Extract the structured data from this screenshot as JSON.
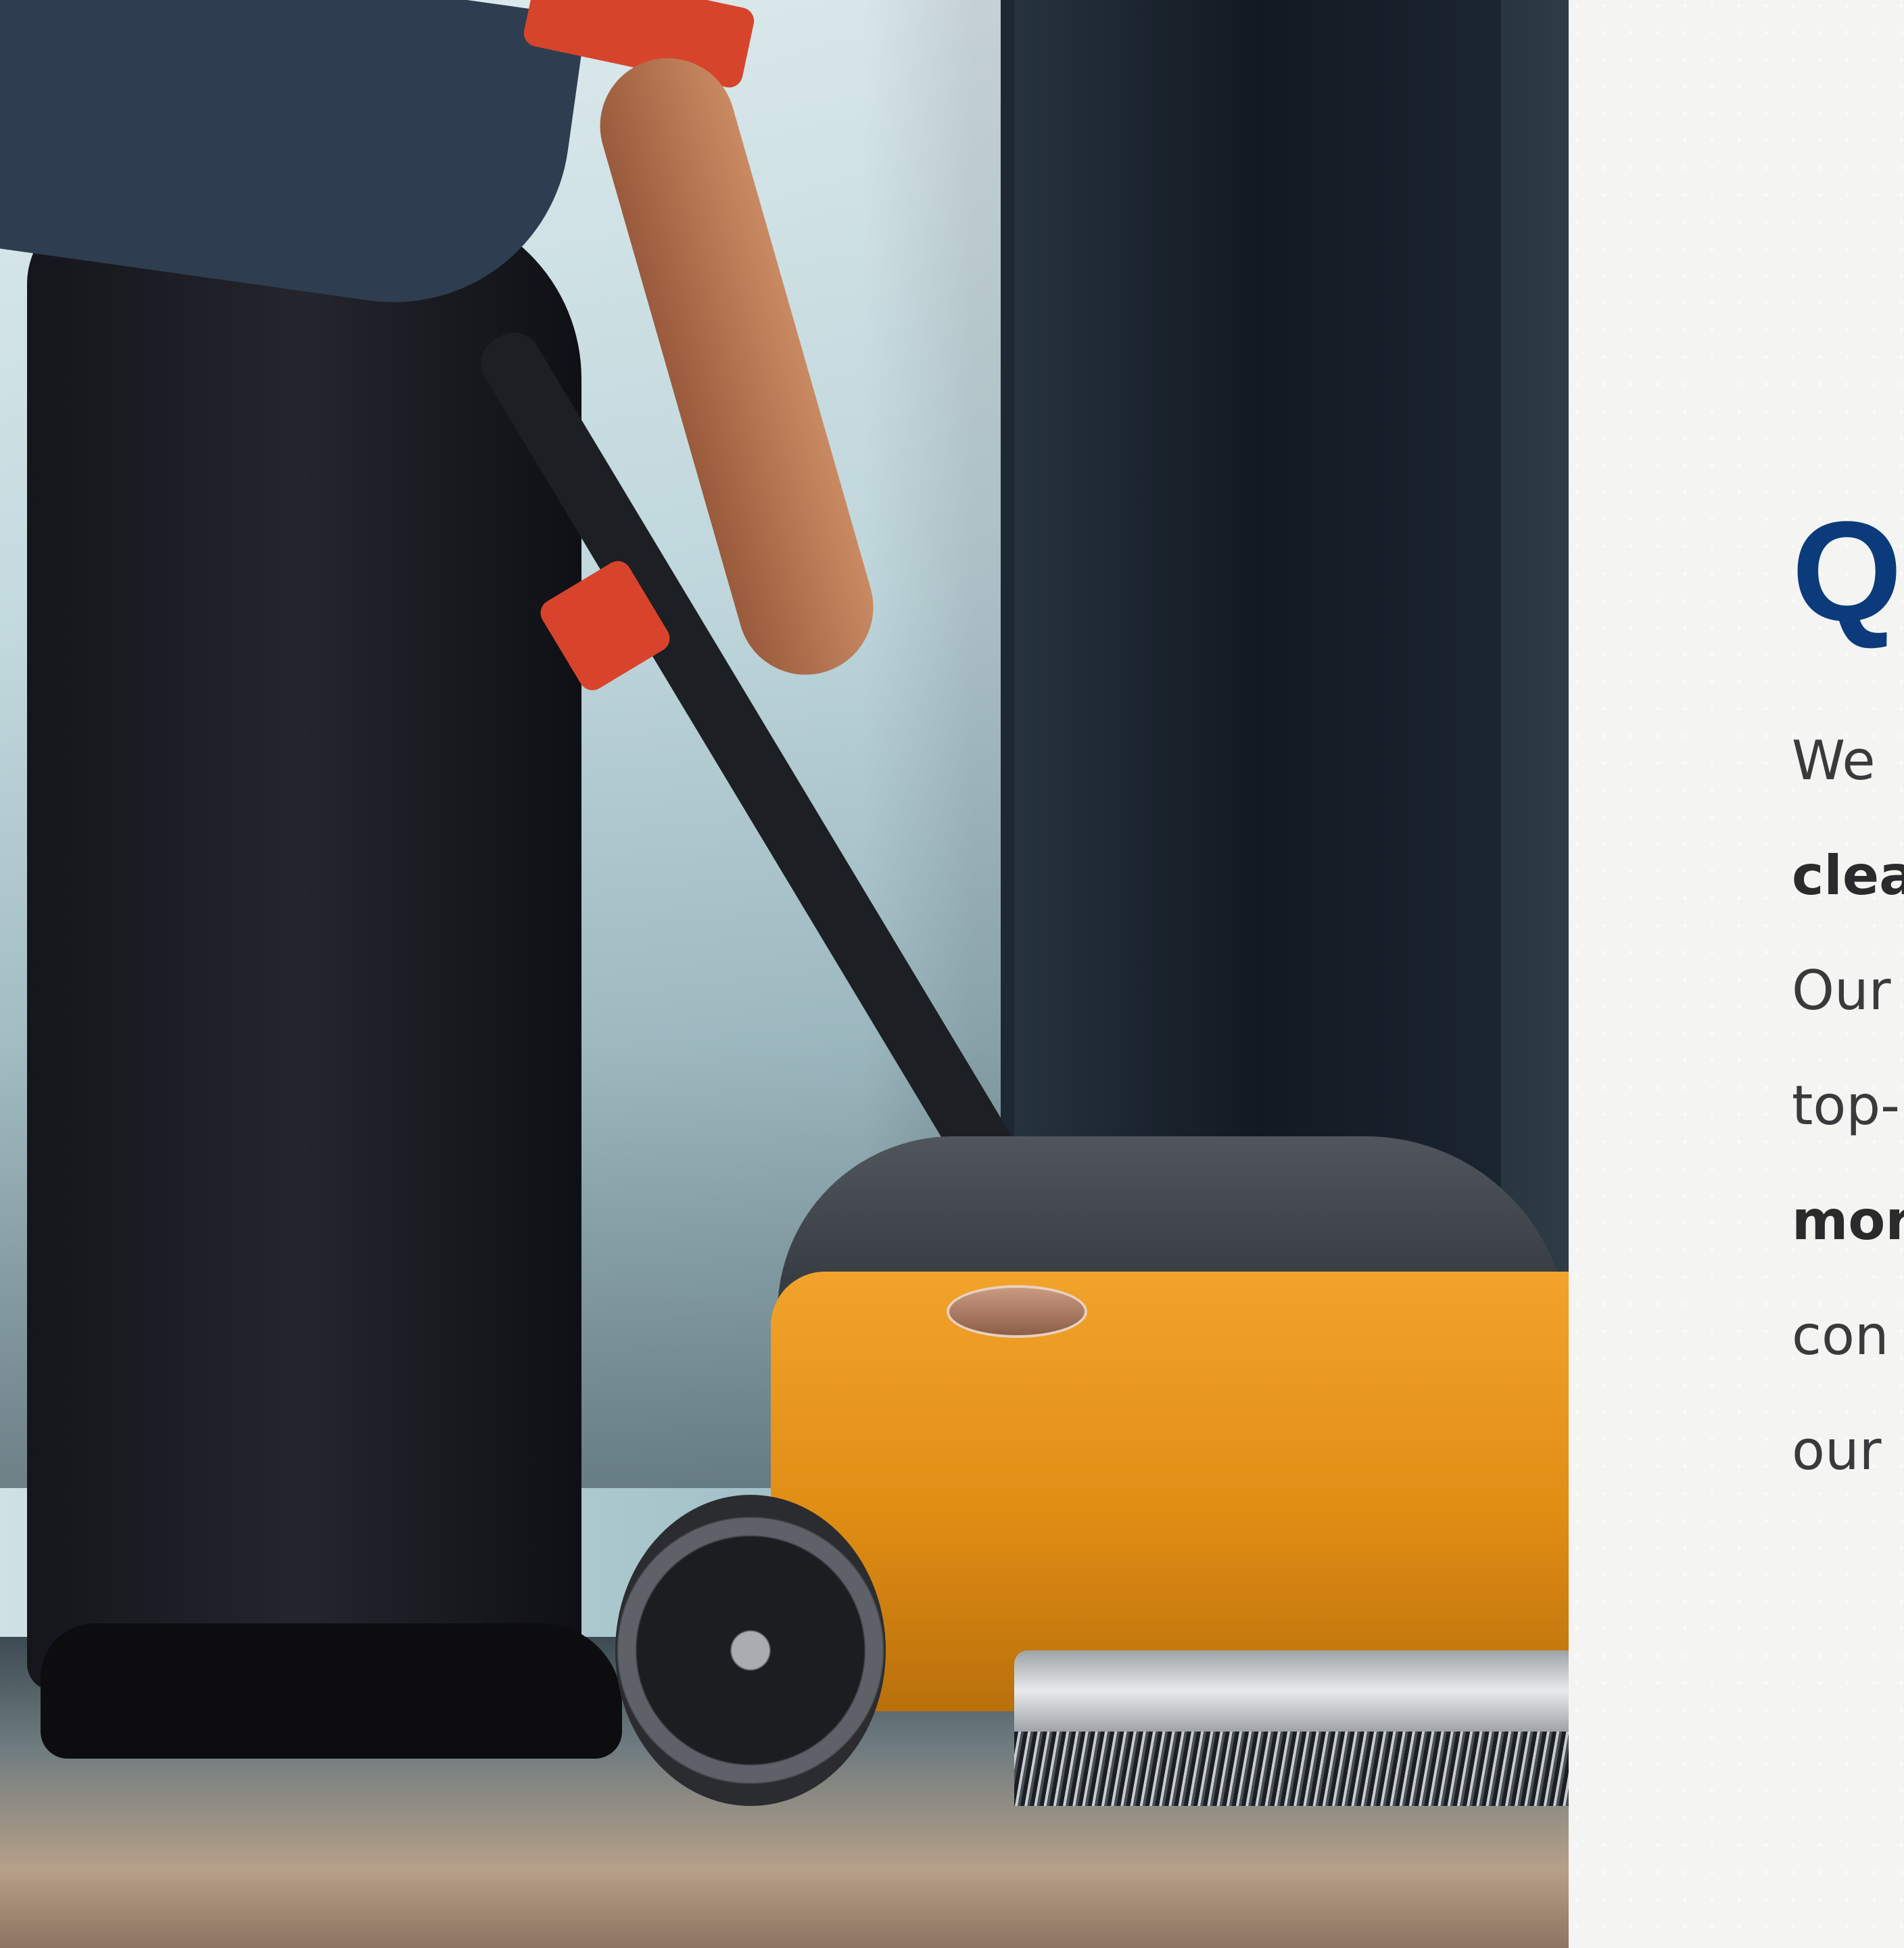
{
  "hero": {
    "image_description_icon": "floor-scrubber-photo",
    "machine_badge_text": ""
  },
  "panel": {
    "heading": "Q",
    "lines": [
      {
        "text": "We",
        "bold": false
      },
      {
        "text": "clea",
        "bold": true
      },
      {
        "text": "Our",
        "bold": false
      },
      {
        "text": "top-",
        "bold": false
      },
      {
        "text": "mor",
        "bold": true
      },
      {
        "text": "con",
        "bold": false
      },
      {
        "text": "our",
        "bold": false
      }
    ]
  },
  "colors": {
    "heading": "#0b3b7a",
    "body_text": "#3a3a3c",
    "machine": "#e08d14",
    "grip": "#d8442b",
    "panel_bg": "#f4f4f2"
  }
}
